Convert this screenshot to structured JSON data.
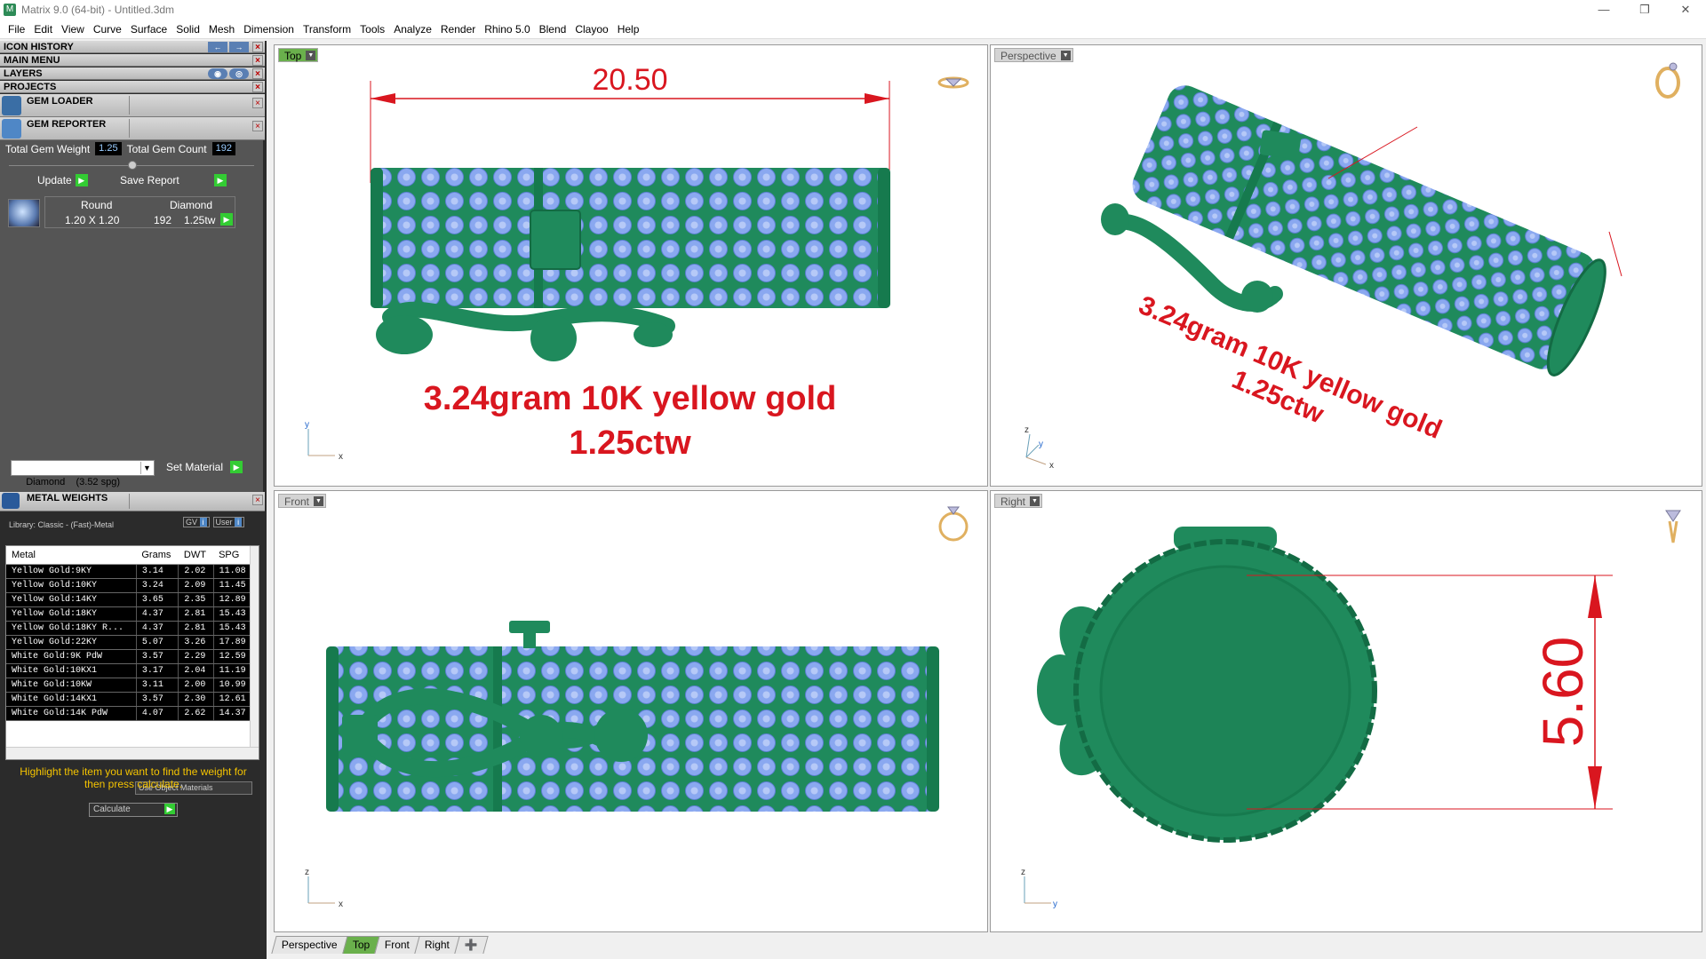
{
  "window": {
    "title": "Matrix 9.0 (64-bit) - Untitled.3dm"
  },
  "menu": [
    "File",
    "Edit",
    "View",
    "Curve",
    "Surface",
    "Solid",
    "Mesh",
    "Dimension",
    "Transform",
    "Tools",
    "Analyze",
    "Render",
    "Rhino 5.0",
    "Blend",
    "Clayoo",
    "Help"
  ],
  "panels": {
    "icon_history": "ICON HISTORY",
    "main_menu": "MAIN MENU",
    "layers": "LAYERS",
    "projects": "PROJECTS",
    "gem_loader": "GEM LOADER",
    "gem_reporter": "GEM REPORTER"
  },
  "gem_reporter": {
    "total_weight_label": "Total Gem Weight",
    "total_weight": "1.25",
    "total_count_label": "Total Gem Count",
    "total_count": "192",
    "update_label": "Update",
    "save_report_label": "Save Report",
    "col_shape": "Round",
    "col_material": "Diamond",
    "size": "1.20 X 1.20",
    "count": "192",
    "weight": "1.25tw",
    "material_select": "Diamond    (3.52 spg)",
    "set_material_label": "Set Material"
  },
  "metal_weights": {
    "title": "METAL WEIGHTS",
    "library": "Library: Classic - (Fast)-Metal",
    "gv_label": "GV",
    "user_label": "User",
    "columns": [
      "Metal",
      "Grams",
      "DWT",
      "SPG"
    ],
    "rows": [
      [
        "Yellow Gold:9KY",
        "3.14",
        "2.02",
        "11.08"
      ],
      [
        "Yellow Gold:10KY",
        "3.24",
        "2.09",
        "11.45"
      ],
      [
        "Yellow Gold:14KY",
        "3.65",
        "2.35",
        "12.89"
      ],
      [
        "Yellow Gold:18KY",
        "4.37",
        "2.81",
        "15.43"
      ],
      [
        "Yellow Gold:18KY R...",
        "4.37",
        "2.81",
        "15.43"
      ],
      [
        "Yellow Gold:22KY",
        "5.07",
        "3.26",
        "17.89"
      ],
      [
        "White Gold:9K PdW",
        "3.57",
        "2.29",
        "12.59"
      ],
      [
        "White Gold:10KX1",
        "3.17",
        "2.04",
        "11.19"
      ],
      [
        "White Gold:10KW",
        "3.11",
        "2.00",
        "10.99"
      ],
      [
        "White Gold:14KX1",
        "3.57",
        "2.30",
        "12.61"
      ],
      [
        "White Gold:14K PdW",
        "4.07",
        "2.62",
        "14.37"
      ]
    ],
    "use_object_materials": "Use Object Materials",
    "hint": "Highlight the item you want to find the weight for then press calculate.",
    "calculate_label": "Calculate"
  },
  "viewports": {
    "top": {
      "label": "Top",
      "dimension": "20.50",
      "line1": "3.24gram 10K yellow gold",
      "line2": "1.25ctw",
      "ax_x": "x",
      "ax_y": "y"
    },
    "perspective": {
      "label": "Perspective",
      "line1": "3.24gram 10K yellow gold",
      "line2": "1.25ctw",
      "ax_x": "x",
      "ax_y": "y",
      "ax_z": "z"
    },
    "front": {
      "label": "Front",
      "ax_x": "x",
      "ax_z": "z"
    },
    "right": {
      "label": "Right",
      "dimension": "5.60",
      "ax_y": "y",
      "ax_z": "z"
    }
  },
  "tabs": [
    "Perspective",
    "Top",
    "Front",
    "Right"
  ],
  "colors": {
    "metal": "#1f8a5c",
    "metal_dark": "#136b44",
    "gem": "#8aa8f0",
    "annotation": "#d9161f",
    "active": "#6ab04c"
  }
}
